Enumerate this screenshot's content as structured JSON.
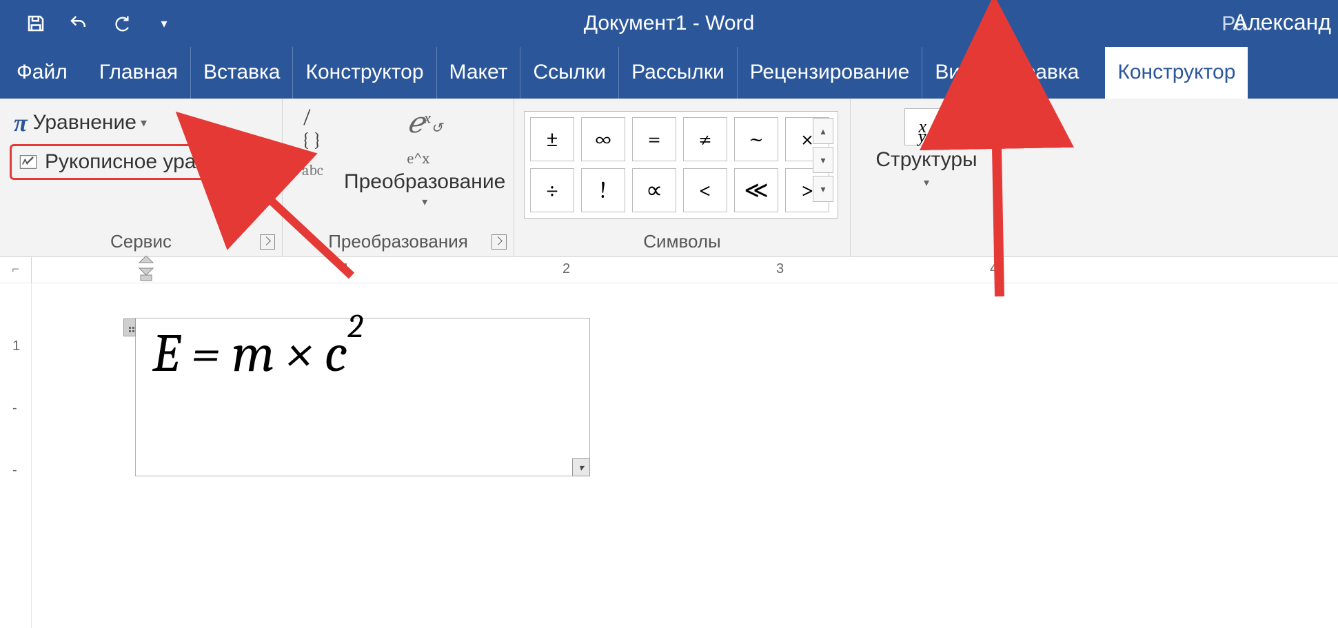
{
  "titlebar": {
    "title": "Документ1 - Word",
    "tool_options_truncated": "Ра...",
    "username": "Александ"
  },
  "tabs": {
    "file": "Файл",
    "items": [
      "Главная",
      "Вставка",
      "Конструктор",
      "Макет",
      "Ссылки",
      "Рассылки",
      "Рецензирование",
      "Вид",
      "Справка"
    ],
    "active": "Конструктор"
  },
  "ribbon": {
    "service": {
      "equation_label": "Уравнение",
      "ink_label": "Рукописное уравнение",
      "group_label": "Сервис"
    },
    "conversion": {
      "linear_slash": "/",
      "braces": "{ }",
      "abc": "abc",
      "convert_icon_top": "e",
      "convert_icon_sup": "x",
      "convert_icon_bottom": "e^x",
      "button_label": "Преобразование",
      "group_label": "Преобразования"
    },
    "symbols": {
      "grid": [
        "±",
        "∞",
        "=",
        "≠",
        "~",
        "×",
        "÷",
        "!",
        "∝",
        "<",
        "≪",
        ">"
      ],
      "group_label": "Символы"
    },
    "structures": {
      "icon_text": "x⁄y",
      "label": "Структуры"
    }
  },
  "ruler": {
    "marks": [
      "1",
      "2",
      "3",
      "4"
    ]
  },
  "vruler": {
    "marks": [
      "1",
      "-",
      "-"
    ]
  },
  "document": {
    "equation": "E = m × c",
    "equation_sup": "2"
  }
}
